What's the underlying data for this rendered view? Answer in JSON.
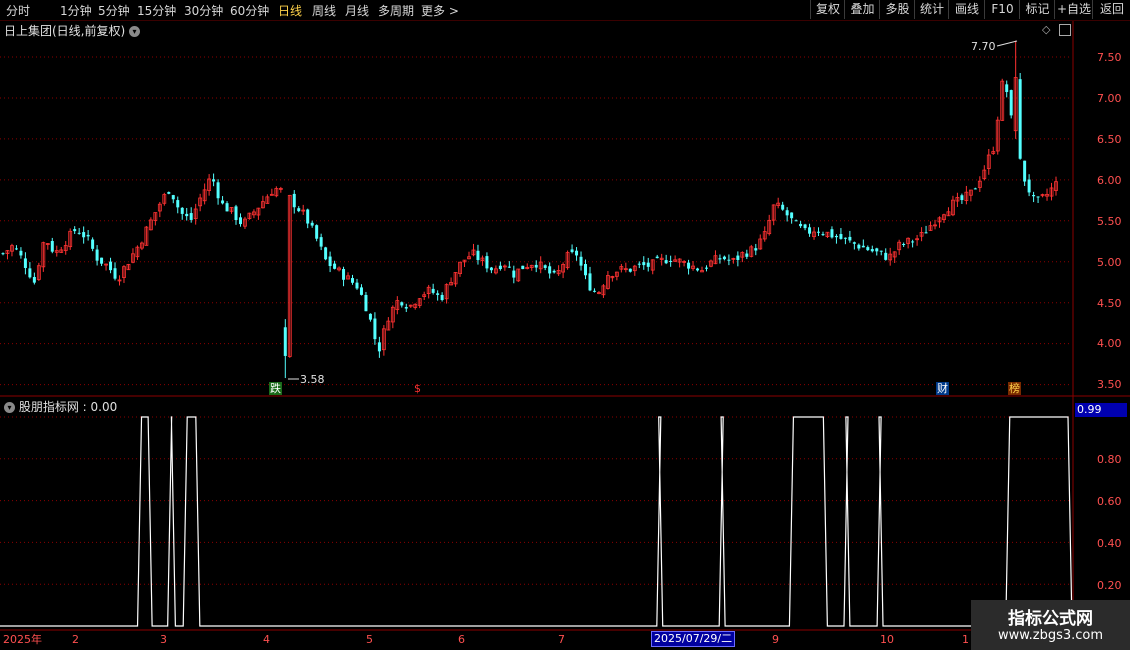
{
  "toolbar": {
    "periods": [
      "分时",
      "1分钟",
      "5分钟",
      "15分钟",
      "30分钟",
      "60分钟",
      "日线",
      "周线",
      "月线",
      "多周期",
      "更多 >"
    ],
    "active_period": "日线",
    "right_buttons": [
      "复权",
      "叠加",
      "多股",
      "统计",
      "画线",
      "F10",
      "标记",
      "+自选",
      "返回"
    ]
  },
  "main_chart": {
    "title": "日上集团(日线,前复权)",
    "y_ticks": [
      "7.50",
      "7.00",
      "6.50",
      "6.00",
      "5.50",
      "5.00",
      "4.50",
      "4.00",
      "3.50"
    ],
    "high_label": "7.70",
    "low_label": "3.58",
    "markers": {
      "die": "跌",
      "shen": "$",
      "cai": "财",
      "bang": "榜"
    }
  },
  "indicator": {
    "title": "股朋指标网 : 0.00",
    "value_box": "0.99",
    "y_ticks": [
      "0.80",
      "0.60",
      "0.40",
      "0.20"
    ]
  },
  "x_axis": {
    "labels": [
      "2025年",
      "2",
      "3",
      "4",
      "5",
      "6",
      "7",
      "9",
      "10",
      "1"
    ],
    "cursor_date": "2025/07/29/二"
  },
  "watermark": {
    "title": "指标公式网",
    "url": "www.zbgs3.com"
  },
  "colors": {
    "up": "#ff3232",
    "down": "#54ffff",
    "grid": "#8b0000",
    "line": "#ffffff",
    "bg": "#000000"
  },
  "chart_data": [
    {
      "type": "candlestick",
      "title": "日上集团(日线,前复权)",
      "ylim": [
        3.4,
        7.85
      ],
      "y_ticks": [
        3.5,
        4.0,
        4.5,
        5.0,
        5.5,
        6.0,
        6.5,
        7.0,
        7.5
      ],
      "x_labels": [
        "2025年",
        "2",
        "3",
        "4",
        "5",
        "6",
        "7",
        "9",
        "10",
        "1"
      ],
      "max_value": 7.7,
      "min_value": 3.58,
      "close_path": [
        5.1,
        5.2,
        5.0,
        4.75,
        5.3,
        5.1,
        5.25,
        5.4,
        5.3,
        5.05,
        4.95,
        4.8,
        5.0,
        5.2,
        5.45,
        5.7,
        5.9,
        5.6,
        5.5,
        5.8,
        6.05,
        5.7,
        5.6,
        5.45,
        5.6,
        5.75,
        5.9,
        5.85,
        5.7,
        5.55,
        5.3,
        5.0,
        4.9,
        4.8,
        4.7,
        4.4,
        3.9,
        4.35,
        4.55,
        4.45,
        4.6,
        4.65,
        4.55,
        4.8,
        5.0,
        5.1,
        5.0,
        4.9,
        5.0,
        4.85,
        4.95,
        5.0,
        4.9,
        4.8,
        5.05,
        5.1,
        4.75,
        4.6,
        4.85,
        4.9,
        4.9,
        4.95,
        4.95,
        5.0,
        5.05,
        5.0,
        4.95,
        4.9,
        5.0,
        5.05,
        5.0,
        5.1,
        5.15,
        5.3,
        5.7,
        5.6,
        5.45,
        5.35,
        5.4,
        5.35,
        5.3,
        5.25,
        5.2,
        5.15,
        5.1,
        5.05,
        5.2,
        5.25,
        5.3,
        5.45,
        5.6,
        5.7,
        5.75,
        5.85,
        6.1,
        6.4,
        7.3,
        6.5,
        6.0,
        5.7,
        5.8,
        5.95
      ]
    },
    {
      "type": "line",
      "title": "股朋指标网 : 0.00",
      "ylim": [
        0,
        1.0
      ],
      "y_ticks": [
        0.2,
        0.4,
        0.6,
        0.8
      ],
      "value_box": 0.99,
      "high_intervals": [
        [
          0.1283,
          0.1419
        ],
        [
          0.1564,
          0.1636
        ],
        [
          0.1709,
          0.1864
        ],
        [
          0.6127,
          0.6182
        ],
        [
          0.6709,
          0.6764
        ],
        [
          0.7364,
          0.7718
        ],
        [
          0.7873,
          0.7928
        ],
        [
          0.8182,
          0.8237
        ],
        [
          0.9382,
          1.0
        ]
      ]
    }
  ]
}
